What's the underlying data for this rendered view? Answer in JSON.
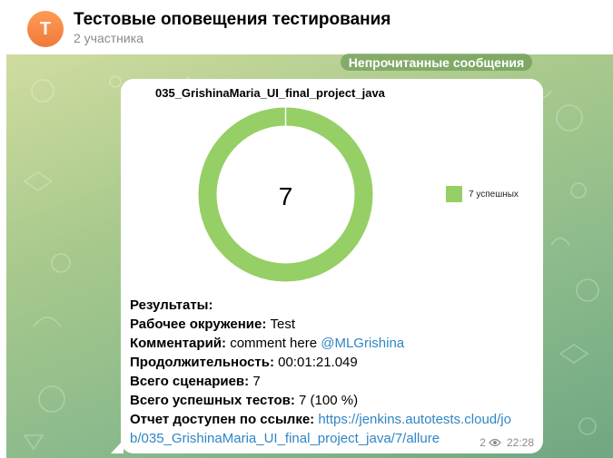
{
  "header": {
    "avatar_letter": "Т",
    "title": "Тестовые оповещения тестирования",
    "subtitle": "2 участника"
  },
  "unread_label": "Непрочитанные сообщения",
  "message": {
    "report_title": "035_GrishinaMaria_UI_final_project_java",
    "donut_center": "7",
    "legend_label": "7 успешных",
    "lines": {
      "results_label": "Результаты:",
      "env_label": "Рабочее окружение:",
      "env_value": "Test",
      "comment_label": "Комментарий:",
      "comment_value": "comment here",
      "comment_mention": "@MLGrishina",
      "duration_label": "Продолжительность:",
      "duration_value": "00:01:21.049",
      "scenarios_label": "Всего сценариев:",
      "scenarios_value": "7",
      "passed_label": "Всего успешных тестов:",
      "passed_value": "7 (100 %)",
      "report_label": "Отчет доступен по ссылке:",
      "report_link_1": "https://jenkins.autotests.cloud/jo",
      "report_link_2": "b/035_GrishinaMaria_UI_final_project_java/7/allure"
    },
    "views": "2",
    "time": "22:28"
  },
  "colors": {
    "accent": "#95cf65",
    "link": "#2f86c4",
    "avatar": "#f58a45"
  },
  "icons": {
    "views": "eye-icon"
  },
  "chart_data": {
    "type": "pie",
    "categories": [
      "7 успешных"
    ],
    "values": [
      7
    ],
    "title": "035_GrishinaMaria_UI_final_project_java"
  }
}
